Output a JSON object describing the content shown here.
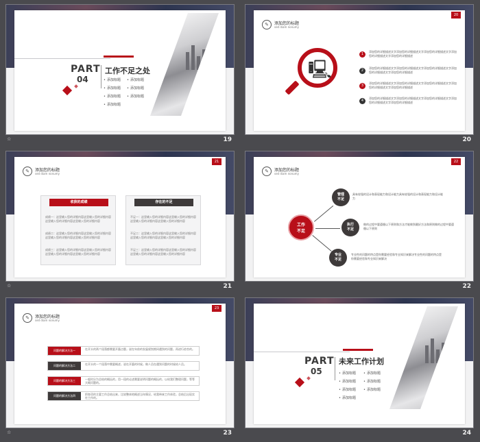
{
  "slides": [
    {
      "page": "19",
      "part_word": "PART",
      "part_num": "04",
      "title": "工作不足之处",
      "bullets_left": [
        "添加标题",
        "添加标题",
        "添加标题",
        "添加标题"
      ],
      "bullets_right": [
        "添加标题",
        "添加标题",
        "添加标题"
      ]
    },
    {
      "page": "20",
      "badge": "20",
      "header_title": "添加您的标题",
      "header_sub": "sed diam nonumy",
      "items": [
        {
          "num": "1",
          "color": "#b80f19",
          "text": "添加您的详细描述文字添加您的详细描述文字添加您的详细描述文字添加您的详细描述文字添加您的详细描述"
        },
        {
          "num": "2",
          "color": "#333333",
          "text": "添加您的详细描述文字添加您的详细描述文字添加您的详细描述文字添加您的详细描述文字添加您的详细描述"
        },
        {
          "num": "3",
          "color": "#b80f19",
          "text": "添加您的详细描述文字添加您的详细描述文字添加您的详细描述文字添加您的详细描述文字添加您的详细描述"
        },
        {
          "num": "4",
          "color": "#333333",
          "text": "添加您的详细描述文字添加您的详细描述文字添加您的详细描述文字添加您的详细描述文字添加您的详细描述"
        }
      ]
    },
    {
      "page": "21",
      "badge": "21",
      "header_title": "添加您的标题",
      "header_sub": "sed diam nonumy",
      "left_label": "收获的成绩",
      "right_label": "存在的不足",
      "left_paras": [
        "成绩一：这里输入您的详细内容这里输入您的详细内容这里输入您的详细内容这里输入您的详细内容",
        "成绩二：这里输入您的详细内容这里输入您的详细内容这里输入您的详细内容这里输入您的详细内容",
        "成绩三：这里输入您的详细内容这里输入您的详细内容这里输入您的详细内容这里输入您的详细内容"
      ],
      "right_paras": [
        "不足一：这里输入您的详细内容这里输入您的详细内容这里输入您的详细内容这里输入您的详细内容",
        "不足二：这里输入您的详细内容这里输入您的详细内容这里输入您的详细内容这里输入您的详细内容",
        "不足三：这里输入您的详细内容这里输入您的详细内容这里输入您的详细内容这里输入您的详细内容"
      ]
    },
    {
      "page": "22",
      "badge": "22",
      "header_title": "添加您的标题",
      "header_sub": "sed diam nonumy",
      "center": "工作\n不足",
      "nodes": [
        {
          "label": "管理\n不足",
          "text": "具有较强的设计和表现能力和设计能力具有较强的设计和表现能力和设计能力"
        },
        {
          "label": "执行\n不足",
          "text": "做的过程中要遵循以下原则和方法才能做到最好方法和原则做的过程中要遵循以下原则"
        },
        {
          "label": "专业\n不足",
          "text": "专业性的问题的特点是你需要经验和专业知识来解决专业性的问题的特点是你需要经验和专业知识来解决"
        }
      ]
    },
    {
      "page": "23",
      "badge": "23",
      "header_title": "添加您的标题",
      "header_sub": "sed diam nonumy",
      "rows": [
        {
          "label": "问题的解决方法一",
          "color": "#b80f19",
          "text": "在开头的两个段落都需要开篇点题，说在年前的发展规划期间遇到的问题，再进行综合的。"
        },
        {
          "label": "问题的解决方法二",
          "color": "#3e3a3a",
          "text": "在开头的一个段落中需要概述，说在开篇的时候，做人员在遇到问题的时候给人员。"
        },
        {
          "label": "问题的解决方法三",
          "color": "#b80f19",
          "text": "一般时分为总结的概括的，用一段的论述需要说明问题的概括的，以给我们整理问题，等等大概问题的。"
        },
        {
          "label": "问题的解决方法四",
          "color": "#3e3a3a",
          "text": "把各项的主要工作总结出来，比较整体地概述当年情况，给我带来工作体验，总结后出现实在工作的。"
        }
      ]
    },
    {
      "page": "24",
      "part_word": "PART",
      "part_num": "05",
      "title": "未来工作计划",
      "bullets_left": [
        "添加标题",
        "添加标题",
        "添加标题",
        "添加标题"
      ],
      "bullets_right": [
        "添加标题",
        "添加标题",
        "添加标题"
      ]
    }
  ],
  "caption_mark": "☆",
  "colors": {
    "accent": "#b80f19",
    "dark": "#3e3a3a"
  }
}
